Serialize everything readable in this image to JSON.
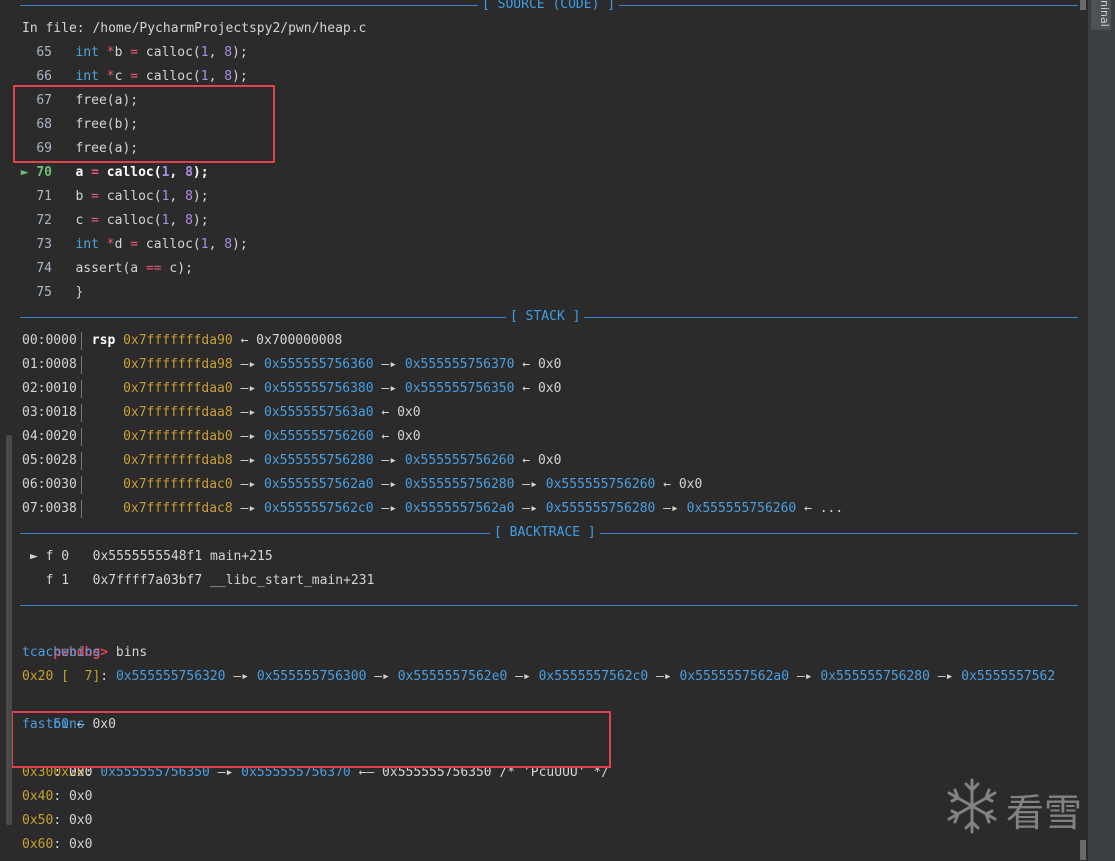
{
  "headers": {
    "source": "[ SOURCE (CODE) ]",
    "stack": "[ STACK ]",
    "backtrace": "[ BACKTRACE ]"
  },
  "source": {
    "file_line": "In file: /home/PycharmProjectspy2/pwn/heap.c",
    "current_marker": "►",
    "lines": [
      {
        "n": "65",
        "kw": "int",
        "rest": [
          " ",
          "*",
          "b ",
          "=",
          " calloc(",
          "1",
          ", ",
          "8",
          ");"
        ]
      },
      {
        "n": "66",
        "kw": "int",
        "rest": [
          " ",
          "*",
          "c ",
          "=",
          " calloc(",
          "1",
          ", ",
          "8",
          ");"
        ]
      },
      {
        "n": "67",
        "code": "free(a);"
      },
      {
        "n": "68",
        "code": "free(b);"
      },
      {
        "n": "69",
        "code": "free(a);"
      },
      {
        "n": "70",
        "a": "a ",
        "eq": "=",
        "call": " calloc(",
        "n1": "1",
        "sep": ", ",
        "n2": "8",
        "end": ");"
      },
      {
        "n": "71",
        "a": "b ",
        "eq": "=",
        "call": " calloc(",
        "n1": "1",
        "sep": ", ",
        "n2": "8",
        "end": ");"
      },
      {
        "n": "72",
        "a": "c ",
        "eq": "=",
        "call": " calloc(",
        "n1": "1",
        "sep": ", ",
        "n2": "8",
        "end": ");"
      },
      {
        "n": "73",
        "kw": "int",
        "rest": [
          " ",
          "*",
          "d ",
          "=",
          " calloc(",
          "1",
          ", ",
          "8",
          ");"
        ]
      },
      {
        "n": "74",
        "a": "assert(a ",
        "eq": "==",
        "end": " c);"
      },
      {
        "n": "75",
        "code": "}"
      }
    ]
  },
  "stack": [
    {
      "off": "00:0000",
      "reg": "rsp",
      "addr": "0x7fffffffda90",
      "chain": [
        {
          "a": "←",
          "v": "0x700000008",
          "c": "w"
        }
      ]
    },
    {
      "off": "01:0008",
      "addr": "0x7fffffffda98",
      "chain": [
        {
          "a": "—▸",
          "v": "0x555555756360",
          "c": "b"
        },
        {
          "a": "—▸",
          "v": "0x555555756370",
          "c": "b"
        },
        {
          "a": "←",
          "v": "0x0",
          "c": "w"
        }
      ]
    },
    {
      "off": "02:0010",
      "addr": "0x7fffffffdaa0",
      "chain": [
        {
          "a": "—▸",
          "v": "0x555555756380",
          "c": "b"
        },
        {
          "a": "—▸",
          "v": "0x555555756350",
          "c": "b"
        },
        {
          "a": "←",
          "v": "0x0",
          "c": "w"
        }
      ]
    },
    {
      "off": "03:0018",
      "addr": "0x7fffffffdaa8",
      "chain": [
        {
          "a": "—▸",
          "v": "0x5555557563a0",
          "c": "b"
        },
        {
          "a": "←",
          "v": "0x0",
          "c": "w"
        }
      ]
    },
    {
      "off": "04:0020",
      "addr": "0x7fffffffdab0",
      "chain": [
        {
          "a": "—▸",
          "v": "0x555555756260",
          "c": "b"
        },
        {
          "a": "←",
          "v": "0x0",
          "c": "w"
        }
      ]
    },
    {
      "off": "05:0028",
      "addr": "0x7fffffffdab8",
      "chain": [
        {
          "a": "—▸",
          "v": "0x555555756280",
          "c": "b"
        },
        {
          "a": "—▸",
          "v": "0x555555756260",
          "c": "b"
        },
        {
          "a": "←",
          "v": "0x0",
          "c": "w"
        }
      ]
    },
    {
      "off": "06:0030",
      "addr": "0x7fffffffdac0",
      "chain": [
        {
          "a": "—▸",
          "v": "0x5555557562a0",
          "c": "b"
        },
        {
          "a": "—▸",
          "v": "0x555555756280",
          "c": "b"
        },
        {
          "a": "—▸",
          "v": "0x555555756260",
          "c": "b"
        },
        {
          "a": "←",
          "v": "0x0",
          "c": "w"
        }
      ]
    },
    {
      "off": "07:0038",
      "addr": "0x7fffffffdac8",
      "chain": [
        {
          "a": "—▸",
          "v": "0x5555557562c0",
          "c": "b"
        },
        {
          "a": "—▸",
          "v": "0x5555557562a0",
          "c": "b"
        },
        {
          "a": "—▸",
          "v": "0x555555756280",
          "c": "b"
        },
        {
          "a": "—▸",
          "v": "0x555555756260",
          "c": "b"
        },
        {
          "a": "←",
          "v": "...",
          "c": "w"
        }
      ]
    }
  ],
  "backtrace": [
    {
      "marker": "►",
      "frame": "f 0",
      "addr": "0x5555555548f1",
      "sym": "main+215"
    },
    {
      "marker": "",
      "frame": "f 1",
      "addr": "0x7ffff7a03bf7",
      "sym": "__libc_start_main+231"
    }
  ],
  "prompt": {
    "name": "pwndbg>",
    "cmd": " bins"
  },
  "bins": {
    "tcache_title": "tcachebins",
    "tcache_size": "0x20",
    "tcache_count": " [  7]",
    "tcache_colon": ": ",
    "tcache_chain_line1": [
      "0x555555756320",
      "0x555555756300",
      "0x5555557562e0",
      "0x5555557562c0",
      "0x5555557562a0",
      "0x555555756280",
      "0x5555557562"
    ],
    "tcache_line2_blue": "60",
    "tcache_line2_rest": " ← 0x0",
    "fast_title": "fastbins",
    "fast_size": "0x20",
    "fast_v1": "0x555555756350",
    "fast_v2": "0x555555756370",
    "fast_tail": " ←— 0x555555756350 /* 'PcuUUU' */",
    "other": [
      {
        "size": "0x30",
        "val": ": 0x0"
      },
      {
        "size": "0x40",
        "val": ": 0x0"
      },
      {
        "size": "0x50",
        "val": ": 0x0"
      },
      {
        "size": "0x60",
        "val": ": 0x0"
      }
    ]
  },
  "side_tab": "ninal",
  "watermark": "看雪",
  "colors": {
    "bg": "#2b2b2b",
    "separator": "#3f7fc5",
    "address_yellow": "#c5a032",
    "pointer_blue": "#4b9ee0",
    "highlight_red": "#e0424f"
  }
}
